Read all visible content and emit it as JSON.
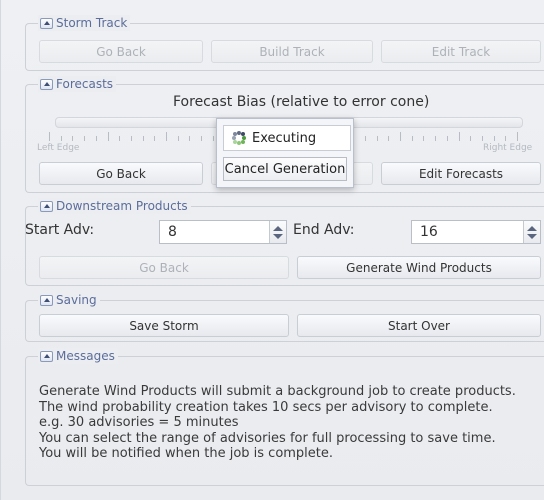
{
  "storm_track": {
    "title": "Storm Track",
    "buttons": [
      "Go Back",
      "Build Track",
      "Edit Track"
    ]
  },
  "forecasts": {
    "title": "Forecasts",
    "bias_label": "Forecast Bias (relative to error cone)",
    "left_edge": "Left Edge",
    "right_edge": "Right Edge",
    "buttons": [
      "Go Back",
      "Edit Forecasts"
    ]
  },
  "downstream": {
    "title": "Downstream Products",
    "start_label": "Start Adv:",
    "start_value": "8",
    "end_label": "End Adv:",
    "end_value": "16",
    "go_back": "Go Back",
    "generate": "Generate Wind Products"
  },
  "saving": {
    "title": "Saving",
    "save": "Save Storm",
    "start_over": "Start Over"
  },
  "messages": {
    "title": "Messages",
    "lines": [
      "Generate Wind Products will submit a background job to create products.",
      "The wind probability creation takes 10 secs per advisory to complete.",
      "e.g. 30 advisories = 5 minutes",
      "You can select the range of advisories for full processing to save time.",
      "You will be notified when the job is complete."
    ]
  },
  "popup": {
    "executing": "Executing",
    "cancel": "Cancel Generation"
  },
  "colors": {
    "legend_text": "#5b6d9a",
    "disabled_text": "#aeb2b8"
  }
}
